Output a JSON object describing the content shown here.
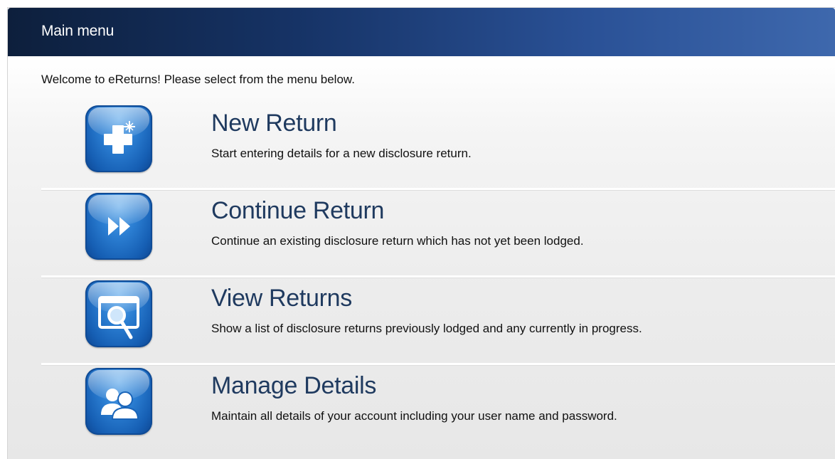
{
  "header": {
    "title": "Main menu"
  },
  "welcome_text": "Welcome to eReturns! Please select from the menu below.",
  "menu_items": [
    {
      "title": "New Return",
      "description": "Start entering details for a new disclosure return.",
      "icon": "plus-icon"
    },
    {
      "title": "Continue Return",
      "description": "Continue an existing disclosure return which has not yet been lodged.",
      "icon": "fast-forward-icon"
    },
    {
      "title": "View Returns",
      "description": "Show a list of disclosure returns previously lodged and any currently in progress.",
      "icon": "magnifier-window-icon"
    },
    {
      "title": "Manage Details",
      "description": "Maintain all details of your account including your user name and password.",
      "icon": "users-icon"
    }
  ],
  "colors": {
    "header_dark": "#0d1f3c",
    "header_light": "#3e68ad",
    "title_text": "#1f3a5f",
    "icon_blue": "#165fb4"
  }
}
